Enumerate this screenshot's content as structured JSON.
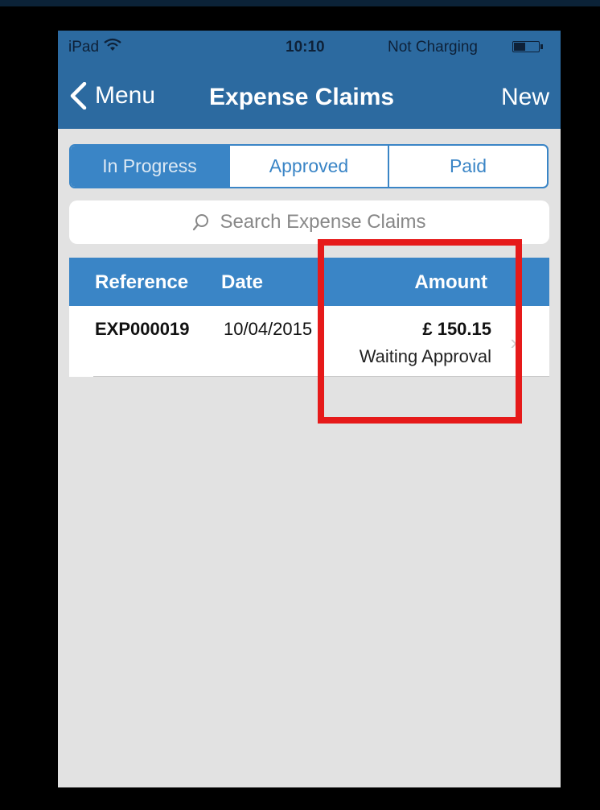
{
  "status_bar": {
    "carrier": "iPad",
    "wifi_icon": "wifi-icon",
    "time": "10:10",
    "charging": "Not Charging",
    "battery_icon": "battery-icon"
  },
  "nav": {
    "back_label": "Menu",
    "back_icon": "chevron-left-icon",
    "title": "Expense Claims",
    "new_label": "New"
  },
  "tabs": [
    {
      "label": "In Progress",
      "selected": true
    },
    {
      "label": "Approved",
      "selected": false
    },
    {
      "label": "Paid",
      "selected": false
    }
  ],
  "search": {
    "placeholder": "Search Expense Claims",
    "icon": "search-icon"
  },
  "table": {
    "columns": [
      "Reference",
      "Date",
      "Amount"
    ],
    "rows": [
      {
        "reference": "EXP000019",
        "date": "10/04/2015",
        "amount": "£ 150.15",
        "status": "Waiting Approval"
      }
    ]
  },
  "colors": {
    "nav_bar": "#2c6aa0",
    "accent": "#3a85c6",
    "background": "#e2e2e2",
    "highlight": "#e61a1a"
  }
}
